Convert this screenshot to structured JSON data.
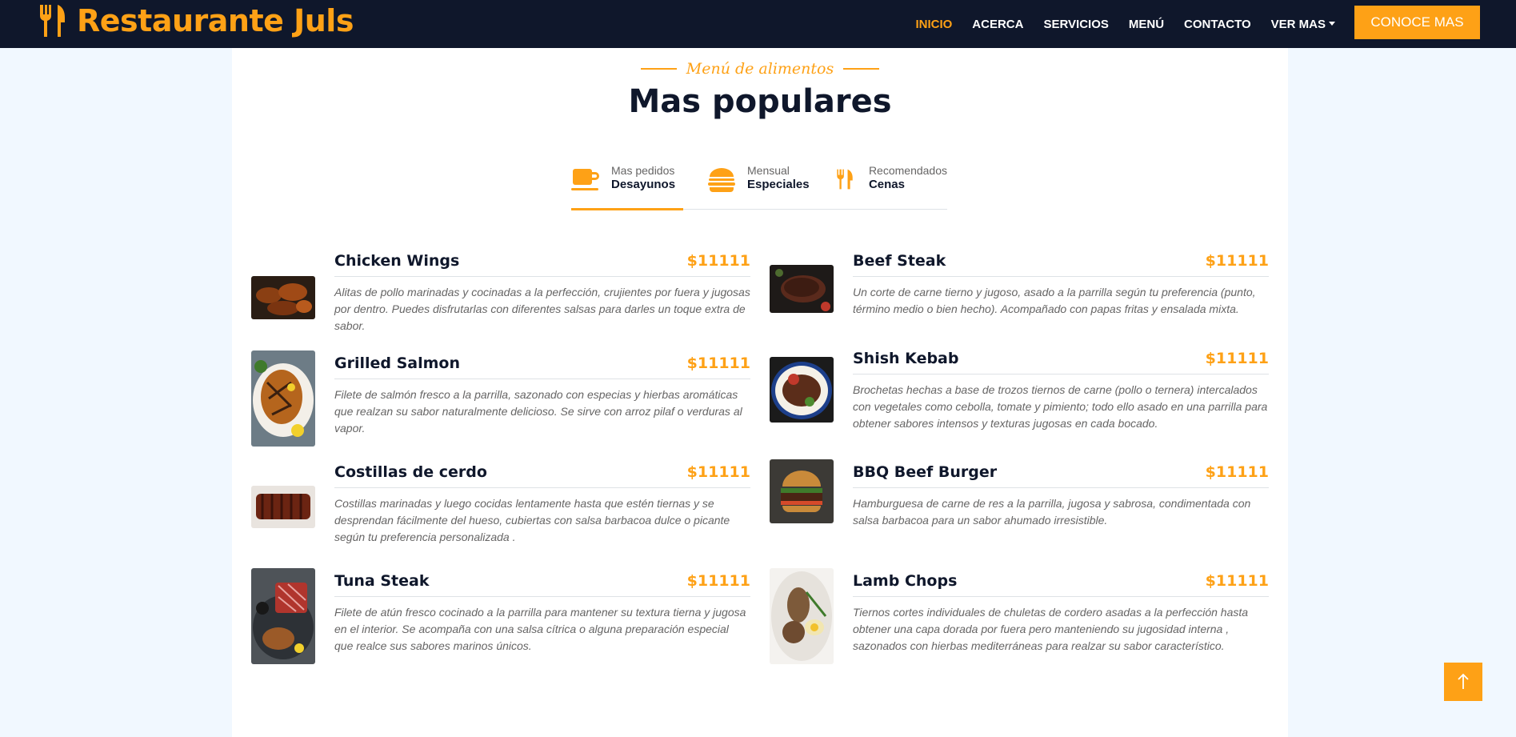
{
  "brand": {
    "name": "Restaurante Juls",
    "icon": "utensils-icon"
  },
  "nav": {
    "items": [
      {
        "label": "INICIO",
        "active": true
      },
      {
        "label": "ACERCA"
      },
      {
        "label": "SERVICIOS"
      },
      {
        "label": "MENÚ"
      },
      {
        "label": "CONTACTO"
      },
      {
        "label": "VER MAS"
      }
    ],
    "cta": "CONOCE MAS"
  },
  "section": {
    "subtitle": "Menú de alimentos",
    "title": "Mas populares"
  },
  "tabs": [
    {
      "small": "Mas pedidos",
      "big": "Desayunos",
      "icon": "coffee-icon",
      "active": true
    },
    {
      "small": "Mensual",
      "big": "Especiales",
      "icon": "hamburger-icon"
    },
    {
      "small": "Recomendados",
      "big": "Cenas",
      "icon": "utensils-icon"
    }
  ],
  "menu": [
    {
      "name": "Chicken Wings",
      "price": "$11111",
      "desc": "Alitas de pollo marinadas y cocinadas a la perfección, crujientes por fuera y jugosas por dentro. Puedes disfrutarlas con diferentes salsas para darles un toque extra de sabor."
    },
    {
      "name": "Beef Steak",
      "price": "$11111",
      "desc": "Un corte de carne tierno y jugoso, asado a la parrilla según tu preferencia (punto, término medio o bien hecho). Acompañado con papas fritas y ensalada mixta."
    },
    {
      "name": "Grilled Salmon",
      "price": "$11111",
      "desc": "Filete de salmón fresco a la parrilla, sazonado con especias y hierbas aromáticas que realzan su sabor naturalmente delicioso. Se sirve con arroz pilaf o verduras al vapor."
    },
    {
      "name": "Shish Kebab",
      "price": "$11111",
      "desc": "Brochetas hechas a base de trozos tiernos de carne (pollo o ternera) intercalados con vegetales como cebolla, tomate y pimiento; todo ello asado en una parrilla para obtener sabores intensos y texturas jugosas en cada bocado."
    },
    {
      "name": "Costillas de cerdo",
      "price": "$11111",
      "desc": "Costillas marinadas y luego cocidas lentamente hasta que estén tiernas y se desprendan fácilmente del hueso, cubiertas con salsa barbacoa dulce o picante según tu preferencia personalizada ."
    },
    {
      "name": "BBQ Beef Burger",
      "price": "$11111",
      "desc": "Hamburguesa de carne de res a la parrilla, jugosa y sabrosa, condimentada con salsa barbacoa para un sabor ahumado irresistible."
    },
    {
      "name": "Tuna Steak",
      "price": "$11111",
      "desc": "Filete de atún fresco cocinado a la parrilla para mantener su textura tierna y jugosa en el interior. Se acompaña con una salsa cítrica o alguna preparación especial que realce sus sabores marinos únicos."
    },
    {
      "name": "Lamb Chops",
      "price": "$11111",
      "desc": "Tiernos cortes individuales de chuletas de cordero asadas a la perfección hasta obtener una capa dorada por fuera pero manteniendo su jugosidad interna , sazonados con hierbas mediterráneas para realzar su sabor característico."
    }
  ],
  "colors": {
    "primary": "#fea116",
    "dark": "#0f172b",
    "light": "#f1f8ff"
  },
  "back_to_top": {
    "icon": "arrow-up-icon"
  }
}
